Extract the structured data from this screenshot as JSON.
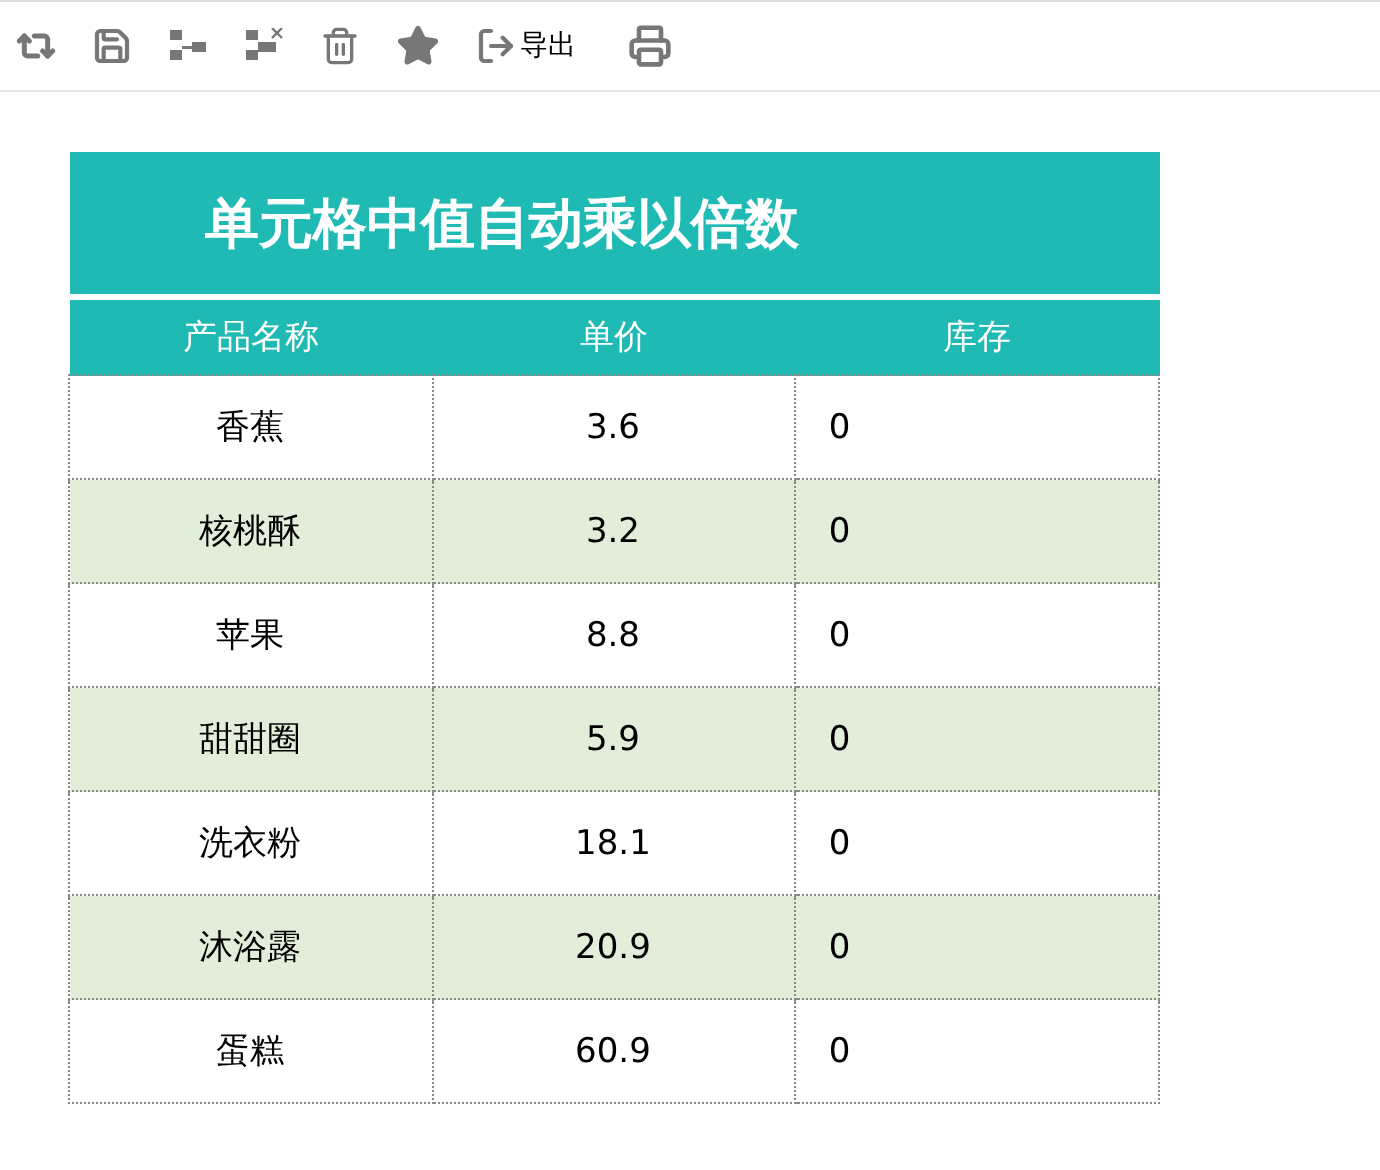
{
  "toolbar": {
    "export_label": "导出"
  },
  "table": {
    "title": "单元格中值自动乘以倍数",
    "columns": [
      "产品名称",
      "单价",
      "库存"
    ],
    "rows": [
      [
        "香蕉",
        "3.6",
        "0"
      ],
      [
        "核桃酥",
        "3.2",
        "0"
      ],
      [
        "苹果",
        "8.8",
        "0"
      ],
      [
        "甜甜圈",
        "5.9",
        "0"
      ],
      [
        "洗衣粉",
        "18.1",
        "0"
      ],
      [
        "沐浴露",
        "20.9",
        "0"
      ],
      [
        "蛋糕",
        "60.9",
        "0"
      ]
    ]
  }
}
